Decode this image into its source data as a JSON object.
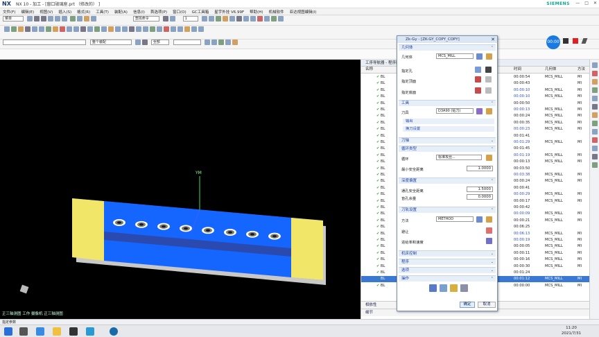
{
  "window": {
    "logo": "NX",
    "title": "NX 10 - 加工 - [窗口玻璃座.prt （修改的） ]",
    "brand": "SIEMENS",
    "controls": [
      "—",
      "□",
      "✕"
    ]
  },
  "menu": [
    "文件(F)",
    "编辑(E)",
    "视图(V)",
    "插入(S)",
    "格式(R)",
    "工具(T)",
    "装配(A)",
    "信息(I)",
    "首选项(P)",
    "窗口(O)",
    "GC工具箱",
    "星宇外挂 V6.99F",
    "帮助(H)",
    "机械软件",
    "亚达视图编辑(I)"
  ],
  "toolbar": {
    "menu_label": "菜单",
    "command_search": "查找命令",
    "scope": "整个装配",
    "filter": "全部",
    "dropdown_value": "1"
  },
  "viewport": {
    "axis_label": "YM",
    "orientation_label": "正三轴测图 工作 摄像机 正三轴测图",
    "colors": {
      "background": "#000000",
      "part": "#1060ff",
      "ends": "#f0e060",
      "edge": "#c0c0c0"
    }
  },
  "navigator": {
    "title": "工序导航器 - 程序顺序",
    "columns": [
      "名称",
      "时间",
      "几何体",
      "方法"
    ],
    "rows": [
      {
        "name": "BL",
        "time": "00:00:54",
        "geom": "MCS_MILL",
        "method": "MI",
        "blue": false
      },
      {
        "name": "BL",
        "time": "00:00:43",
        "geom": "",
        "method": "MI",
        "blue": false
      },
      {
        "name": "BL",
        "time": "00:00:10",
        "geom": "MCS_MILL",
        "method": "MI",
        "blue": true
      },
      {
        "name": "BL",
        "time": "00:00:10",
        "geom": "MCS_MILL",
        "method": "MI",
        "blue": true
      },
      {
        "name": "BL",
        "time": "00:00:50",
        "geom": "",
        "method": "MI",
        "blue": false
      },
      {
        "name": "BL",
        "time": "00:00:13",
        "geom": "MCS_MILL",
        "method": "MI",
        "blue": true
      },
      {
        "name": "BL",
        "time": "00:00:24",
        "geom": "MCS_MILL",
        "method": "MI",
        "blue": false
      },
      {
        "name": "BL",
        "time": "00:00:35",
        "geom": "MCS_MILL",
        "method": "MI",
        "blue": false
      },
      {
        "name": "BL",
        "time": "00:00:23",
        "geom": "MCS_MILL",
        "method": "MI",
        "blue": true
      },
      {
        "name": "BL",
        "time": "00:01:41",
        "geom": "",
        "method": "",
        "blue": false
      },
      {
        "name": "BL",
        "time": "00:01:29",
        "geom": "MCS_MILL",
        "method": "MI",
        "blue": true
      },
      {
        "name": "BL",
        "time": "00:01:45",
        "geom": "",
        "method": "",
        "blue": false
      },
      {
        "name": "BL",
        "time": "00:01:19",
        "geom": "MCS_MILL",
        "method": "MI",
        "blue": true
      },
      {
        "name": "BL",
        "time": "00:00:13",
        "geom": "MCS_MILL",
        "method": "MI",
        "blue": false
      },
      {
        "name": "BL",
        "time": "00:03:50",
        "geom": "",
        "method": "",
        "blue": false
      },
      {
        "name": "BL",
        "time": "00:03:38",
        "geom": "MCS_MILL",
        "method": "MI",
        "blue": true
      },
      {
        "name": "BL",
        "time": "00:00:24",
        "geom": "MCS_MILL",
        "method": "MI",
        "blue": false
      },
      {
        "name": "BL",
        "time": "00:00:41",
        "geom": "",
        "method": "",
        "blue": false
      },
      {
        "name": "BL",
        "time": "00:00:29",
        "geom": "MCS_MILL",
        "method": "MI",
        "blue": true
      },
      {
        "name": "BL",
        "time": "00:00:17",
        "geom": "MCS_MILL",
        "method": "MI",
        "blue": false
      },
      {
        "name": "BL",
        "time": "00:00:42",
        "geom": "",
        "method": "",
        "blue": false
      },
      {
        "name": "BL",
        "time": "00:00:09",
        "geom": "MCS_MILL",
        "method": "MI",
        "blue": true
      },
      {
        "name": "BL",
        "time": "00:00:21",
        "geom": "MCS_MILL",
        "method": "MI",
        "blue": false
      },
      {
        "name": "BL",
        "time": "00:06:25",
        "geom": "",
        "method": "",
        "blue": false
      },
      {
        "name": "BL",
        "time": "00:06:13",
        "geom": "MCS_MILL",
        "method": "MI",
        "blue": true
      },
      {
        "name": "BL",
        "time": "00:00:19",
        "geom": "MCS_MILL",
        "method": "MI",
        "blue": true
      },
      {
        "name": "BL",
        "time": "00:00:05",
        "geom": "MCS_MILL",
        "method": "MI",
        "blue": false
      },
      {
        "name": "BL",
        "time": "00:00:11",
        "geom": "MCS_MILL",
        "method": "MI",
        "blue": false
      },
      {
        "name": "BL",
        "time": "00:00:16",
        "geom": "MCS_MILL",
        "method": "MI",
        "blue": false
      },
      {
        "name": "BL",
        "time": "00:00:30",
        "geom": "MCS_MILL",
        "method": "MI",
        "blue": false
      },
      {
        "name": "BL",
        "time": "00:01:24",
        "geom": "",
        "method": "",
        "blue": false
      },
      {
        "name": "BL",
        "time": "00:01:12",
        "geom": "MCS_MILL",
        "method": "MI",
        "blue": false,
        "selected": true
      },
      {
        "name": "BL",
        "time": "00:00:00",
        "geom": "MCS_MILL",
        "method": "MI",
        "blue": false
      }
    ],
    "footer": [
      "相依性",
      "细节"
    ]
  },
  "dialog": {
    "title": "Zk-Gy - [ZK-GY_COPY_COPY]",
    "sections": {
      "geometry": "几何体",
      "tool": "工具",
      "axis": "刀轴",
      "cycle": "循环类型",
      "depth": "深度偏置",
      "path": "刀轨设置",
      "machine": "机床控制",
      "program": "程序",
      "options": "选项",
      "actions": "操作"
    },
    "geometry": {
      "label": "几何体",
      "value": "MCS_MILL",
      "hole": "指定孔",
      "top": "指定顶面",
      "bottom": "指定底面"
    },
    "tool": {
      "label": "刀具",
      "value": "D3A90 (钻刀)",
      "output": "输出",
      "change": "换刀设置"
    },
    "cycle": {
      "label": "循环",
      "value": "标准攻丝...",
      "min_clear_label": "最小安全距离",
      "min_clear": "1.0000"
    },
    "depth": {
      "through_label": "通孔安全距离",
      "through": "1.5000",
      "blind_label": "盲孔余量",
      "blind": "0.0000"
    },
    "path": {
      "method_label": "方法",
      "method": "METHOD",
      "avoid": "避让",
      "feed": "进给率和速度"
    },
    "buttons": {
      "ok": "确定",
      "cancel": "取消"
    }
  },
  "timer": "00:00",
  "statusbar": "指定参数",
  "clock": {
    "time": "11:20",
    "date": "2021/7/31"
  }
}
